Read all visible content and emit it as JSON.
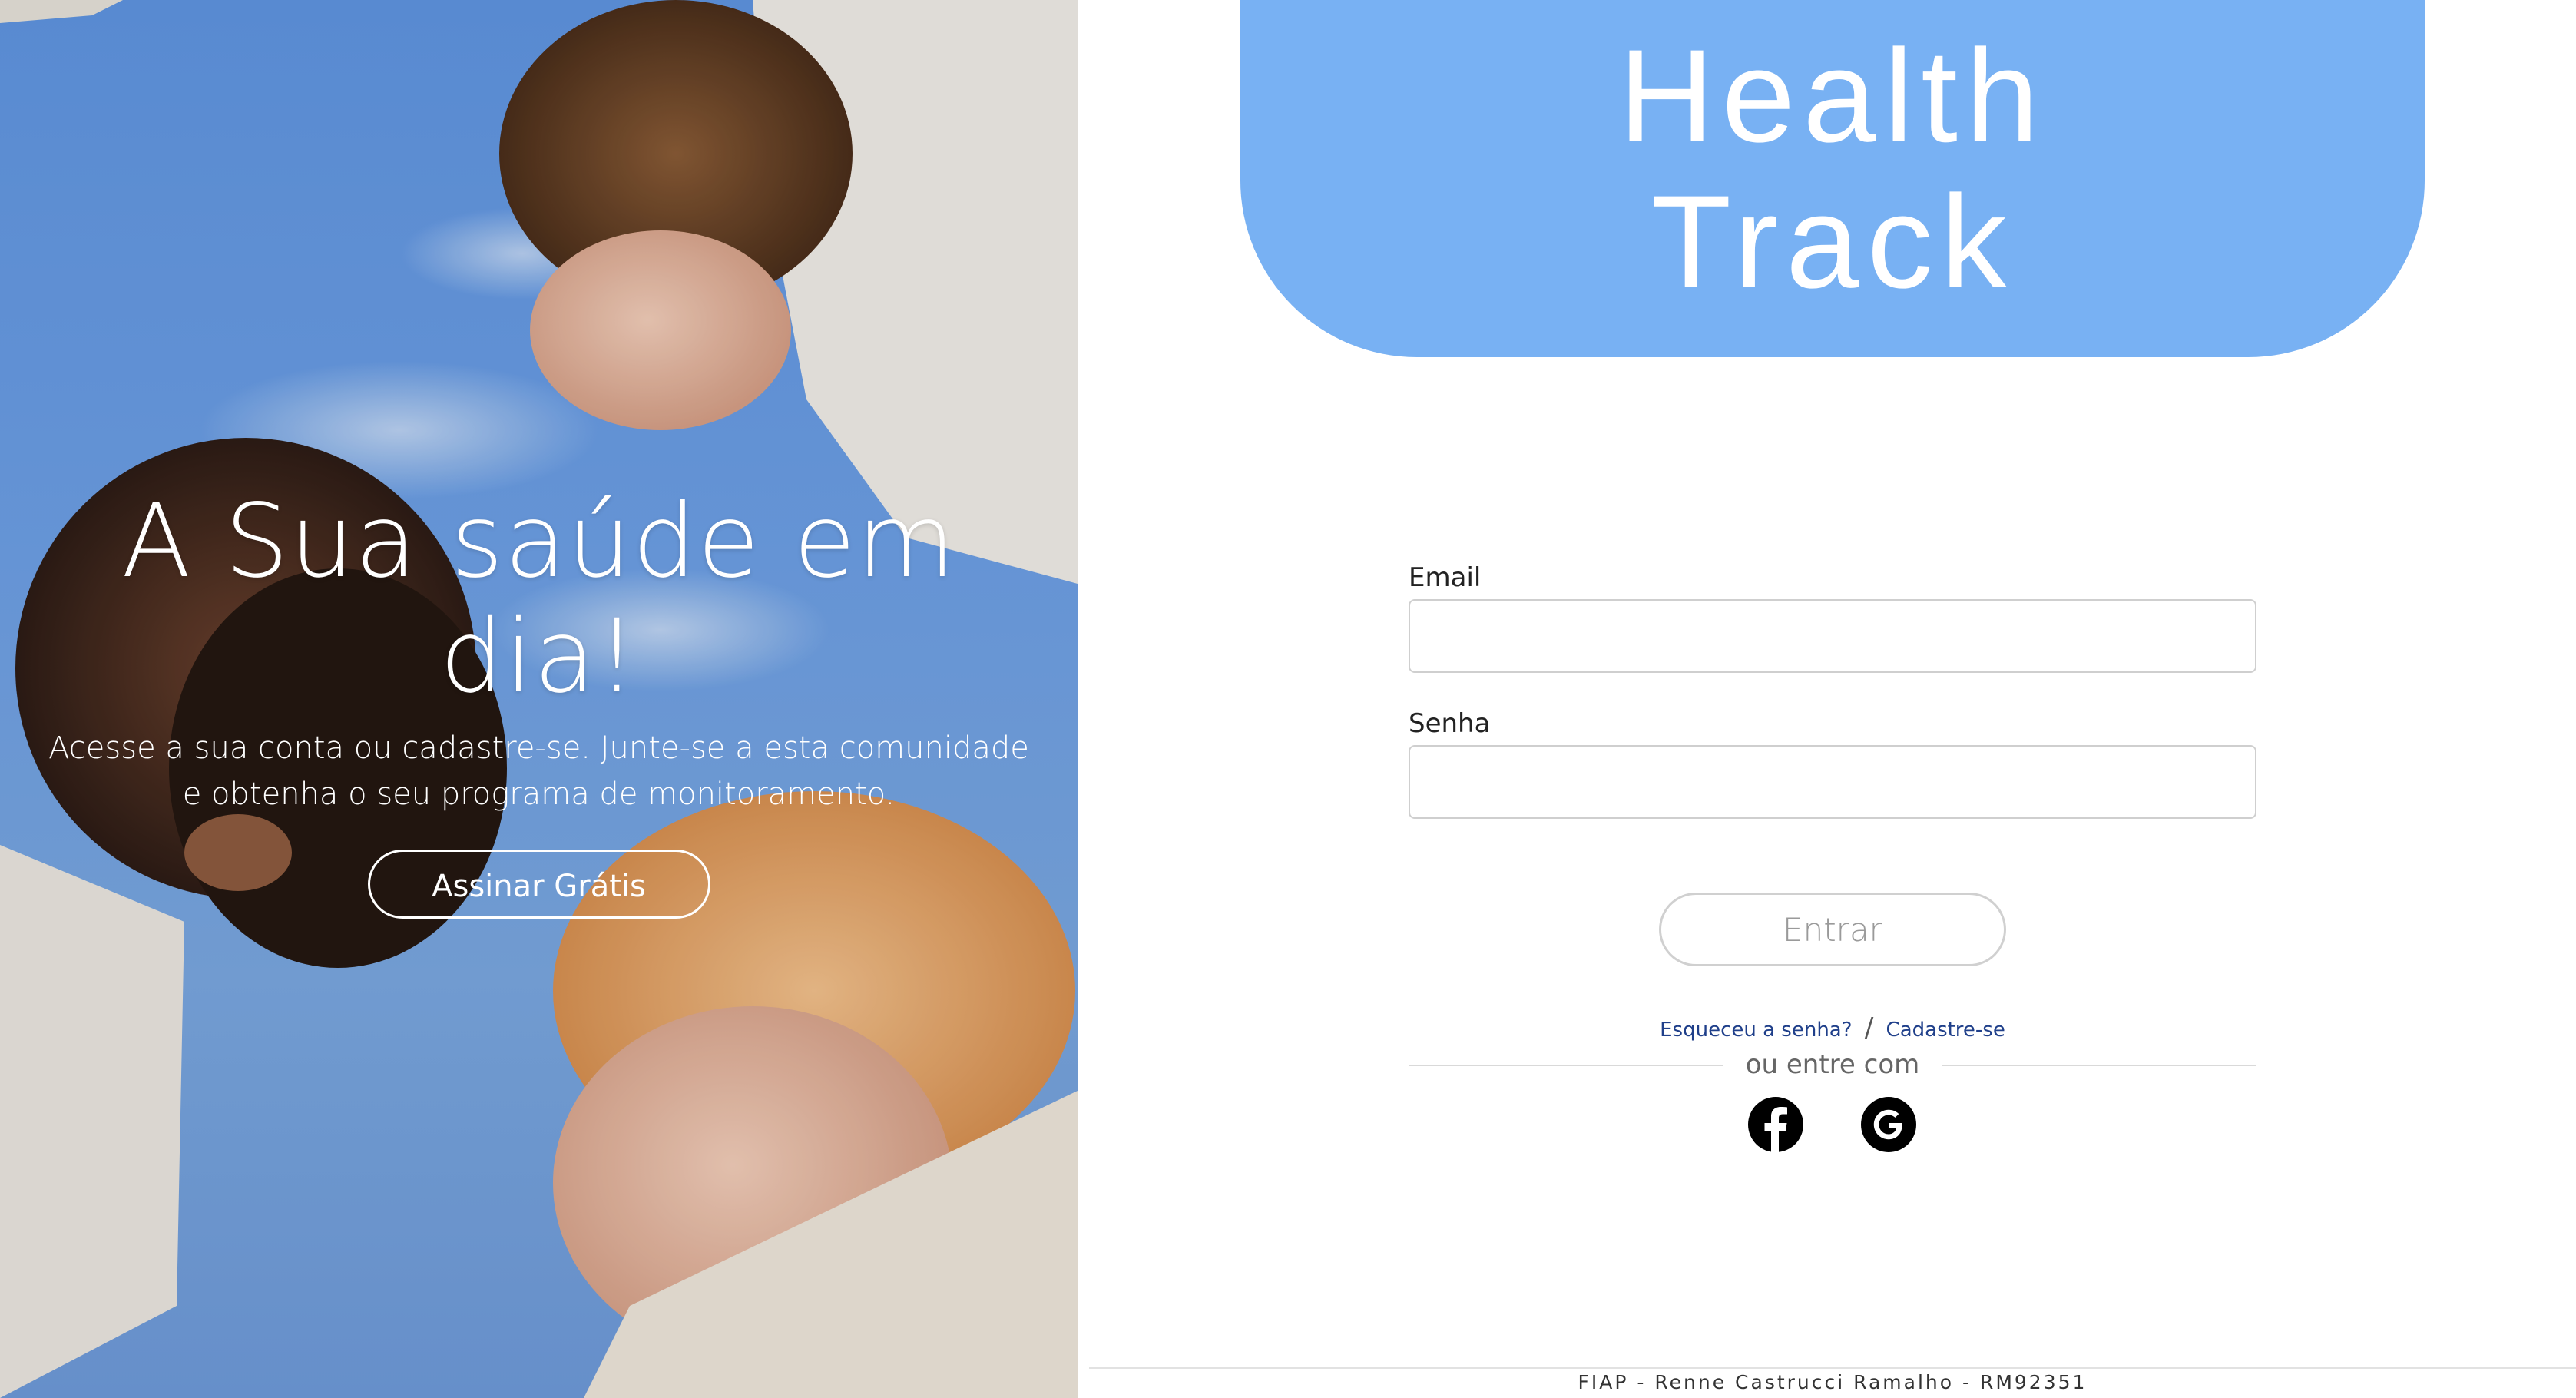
{
  "hero": {
    "title": "A Sua saúde em dia!",
    "subtitle": "Acesse a sua conta ou cadastre-se. Junte-se a esta comunidade e obtenha o seu programa de monitoramento.",
    "cta_label": "Assinar Grátis"
  },
  "brand": {
    "line1": "Health",
    "line2": "Track",
    "color": "#78b1f3"
  },
  "form": {
    "email_label": "Email",
    "email_value": "",
    "password_label": "Senha",
    "password_value": "",
    "submit_label": "Entrar"
  },
  "links": {
    "forgot": "Esqueceu a senha?",
    "separator": "/",
    "signup": "Cadastre-se"
  },
  "social": {
    "divider_text": "ou entre com",
    "icons": [
      "facebook-icon",
      "google-icon"
    ]
  },
  "footer": {
    "text": "FIAP - Renne Castrucci Ramalho - RM92351"
  }
}
